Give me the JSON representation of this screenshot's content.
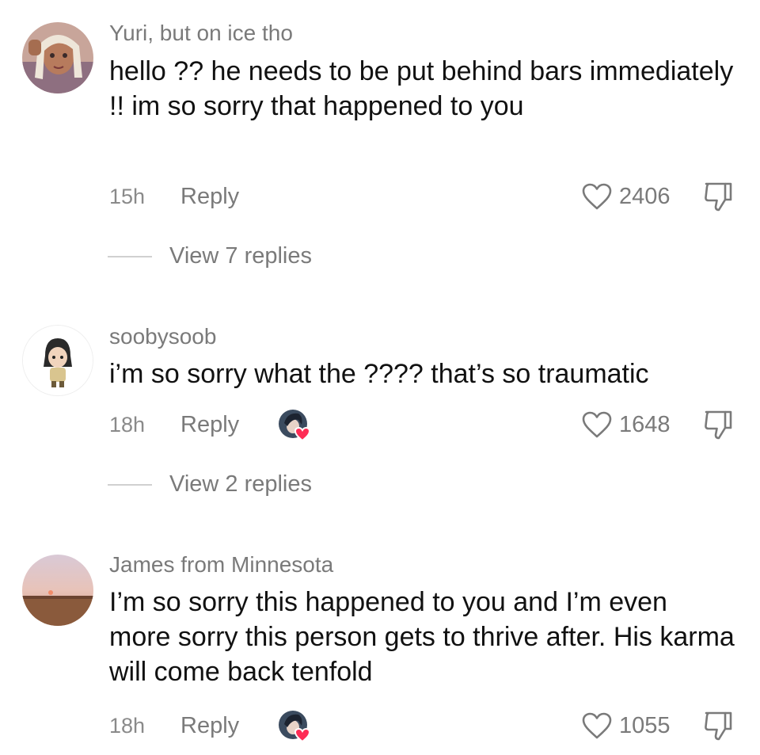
{
  "comments": [
    {
      "username": "Yuri, but on ice tho",
      "text": "hello ?? he needs to be put behind bars immediately !! im so sorry that happened to you",
      "time": "15h",
      "reply_label": "Reply",
      "likes": "2406",
      "view_replies": "View 7 replies",
      "liked_by_creator": false
    },
    {
      "username": "soobysoob",
      "text": "i’m so sorry what the ???? that’s so traumatic",
      "time": "18h",
      "reply_label": "Reply",
      "likes": "1648",
      "view_replies": "View 2 replies",
      "liked_by_creator": true
    },
    {
      "username": "James from Minnesota",
      "text": "I’m so sorry this happened to you and I’m even more sorry this person gets to thrive after. His karma will come back tenfold",
      "time": "18h",
      "reply_label": "Reply",
      "likes": "1055",
      "liked_by_creator": true
    }
  ],
  "colors": {
    "secondary_text": "#7a7a7a",
    "primary_text": "#111111",
    "creator_heart": "#fe2c55"
  },
  "icons": {
    "like": "heart-outline-icon",
    "dislike": "thumbs-down-icon",
    "creator_like": "creator-liked-badge"
  }
}
